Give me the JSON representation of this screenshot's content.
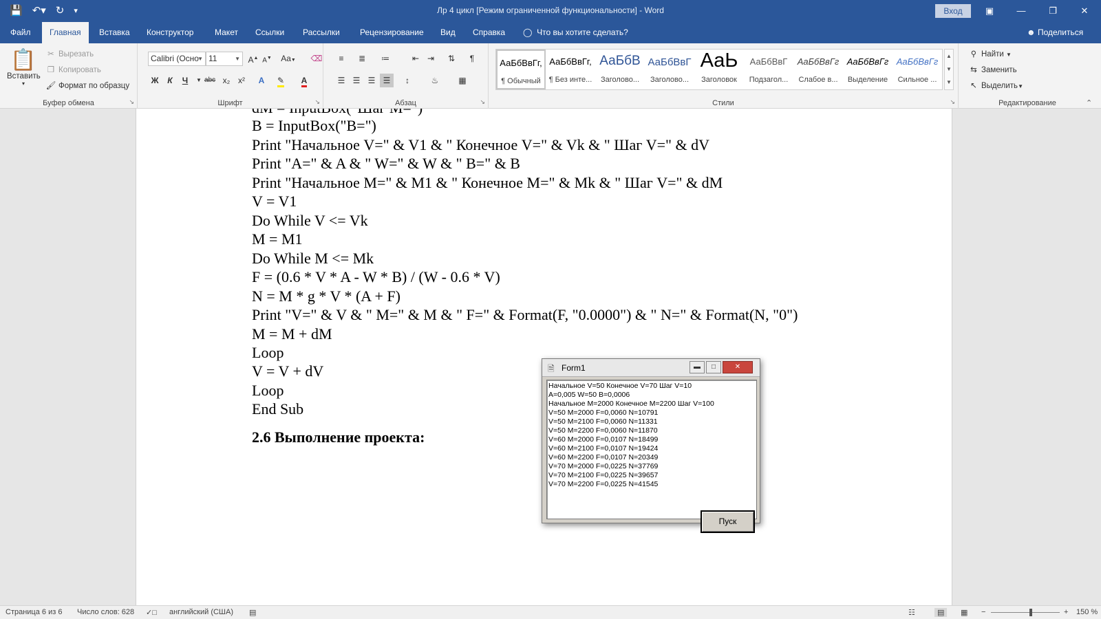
{
  "app": {
    "title": "Лр 4 цикл [Режим ограниченной функциональности]  -  Word",
    "signin": "Вход"
  },
  "qat": {
    "save_icon": "save-icon",
    "undo_icon": "undo-icon",
    "redo_icon": "redo-icon"
  },
  "menu": {
    "tabs": [
      "Файл",
      "Главная",
      "Вставка",
      "Конструктор",
      "Макет",
      "Ссылки",
      "Рассылки",
      "Рецензирование",
      "Вид",
      "Справка"
    ],
    "active": "Главная",
    "tellme": "Что вы хотите сделать?",
    "share": "Поделиться"
  },
  "ribbon": {
    "clipboard": {
      "label": "Буфер обмена",
      "paste": "Вставить",
      "cut": "Вырезать",
      "copy": "Копировать",
      "format_painter": "Формат по образцу"
    },
    "font": {
      "label": "Шрифт",
      "family": "Calibri (Осно",
      "size": "11",
      "bold": "Ж",
      "italic": "К",
      "underline": "Ч",
      "strike": "abc",
      "subscript": "x₂",
      "superscript": "x²",
      "case": "Aa"
    },
    "paragraph": {
      "label": "Абзац"
    },
    "styles": {
      "label": "Стили",
      "items": [
        {
          "preview": "АаБбВвГг,",
          "name": "¶ Обычный"
        },
        {
          "preview": "АаБбВвГг,",
          "name": "¶ Без инте..."
        },
        {
          "preview": "АаБбВ",
          "name": "Заголово..."
        },
        {
          "preview": "АаБбВвГ",
          "name": "Заголово..."
        },
        {
          "preview": "АаЬ",
          "name": "Заголовок"
        },
        {
          "preview": "АаБбВвГ",
          "name": "Подзагол..."
        },
        {
          "preview": "АаБбВвГг",
          "name": "Слабое в..."
        },
        {
          "preview": "АаБбВвГг",
          "name": "Выделение"
        },
        {
          "preview": "АаБбВвГг",
          "name": "Сильное ..."
        }
      ]
    },
    "editing": {
      "label": "Редактирование",
      "find": "Найти",
      "replace": "Заменить",
      "select": "Выделить"
    }
  },
  "document": {
    "partial_top": "dM = InputBox(\"Шаг M=\")",
    "lines": [
      "B = InputBox(\"B=\")",
      "Print \"Начальное V=\" & V1 & \" Конечное V=\" & Vk & \" Шаг V=\" & dV",
      "Print \"A=\" & A & \" W=\" & W & \" B=\" & B",
      "Print \"Начальное M=\" & M1 & \" Конечное M=\" & Mk & \" Шаг V=\" & dM",
      "V = V1",
      "Do While V <= Vk",
      "M = M1",
      "Do While M <= Mk",
      "F = (0.6 * V * A - W * B) / (W - 0.6 * V)",
      "N = M * g * V * (A + F)",
      "Print \"V=\" & V & \" M=\" & M & \" F=\" & Format(F, \"0.0000\") & \" N=\" & Format(N, \"0\")",
      "M = M + dM",
      "Loop",
      "V = V + dV",
      "Loop",
      "End Sub"
    ],
    "heading": "2.6 Выполнение проекта:"
  },
  "form1": {
    "title": "Form1",
    "output": [
      "Начальное V=50 Конечное V=70 Шаг V=10",
      "A=0,005 W=50 B=0,0006",
      "Начальное M=2000 Конечное M=2200 Шаг V=100",
      "V=50 M=2000 F=0,0060 N=10791",
      "V=50 M=2100 F=0,0060 N=11331",
      "V=50 M=2200 F=0,0060 N=11870",
      "V=60 M=2000 F=0,0107 N=18499",
      "V=60 M=2100 F=0,0107 N=19424",
      "V=60 M=2200 F=0,0107 N=20349",
      "V=70 M=2000 F=0,0225 N=37769",
      "V=70 M=2100 F=0,0225 N=39657",
      "V=70 M=2200 F=0,0225 N=41545"
    ],
    "button": "Пуск"
  },
  "status": {
    "page": "Страница 6 из 6",
    "words": "Число слов: 628",
    "language": "английский (США)",
    "zoom": "150 %",
    "zoom_minus": "−",
    "zoom_plus": "+"
  }
}
